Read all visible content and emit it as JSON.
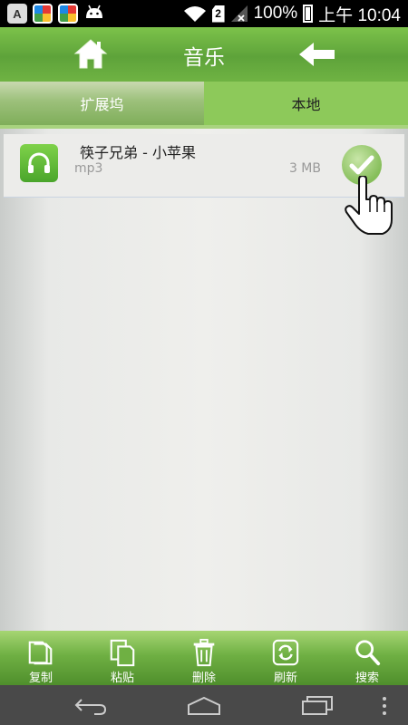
{
  "status_bar": {
    "battery": "100%",
    "time": "上午 10:04",
    "notification_icons": [
      "app-a-icon",
      "pinwheel-icon",
      "pinwheel-icon",
      "android-icon"
    ],
    "notif_a_label": "A",
    "sim_label": "2"
  },
  "header": {
    "title": "音乐"
  },
  "tabs": [
    {
      "label": "扩展坞",
      "selected": false
    },
    {
      "label": "本地",
      "selected": true
    }
  ],
  "files": [
    {
      "name": "筷子兄弟 - 小苹果",
      "type": "mp3",
      "size": "3 MB",
      "checked": true,
      "icon": "headphones-icon"
    }
  ],
  "toolbar": [
    {
      "label": "复制",
      "icon": "copy-icon"
    },
    {
      "label": "粘贴",
      "icon": "paste-icon"
    },
    {
      "label": "删除",
      "icon": "trash-icon"
    },
    {
      "label": "刷新",
      "icon": "refresh-icon"
    },
    {
      "label": "搜索",
      "icon": "search-icon"
    }
  ],
  "colors": {
    "accent_green": "#8dc95a",
    "header_green": "#5ea33a",
    "nav_bar": "#494949"
  }
}
